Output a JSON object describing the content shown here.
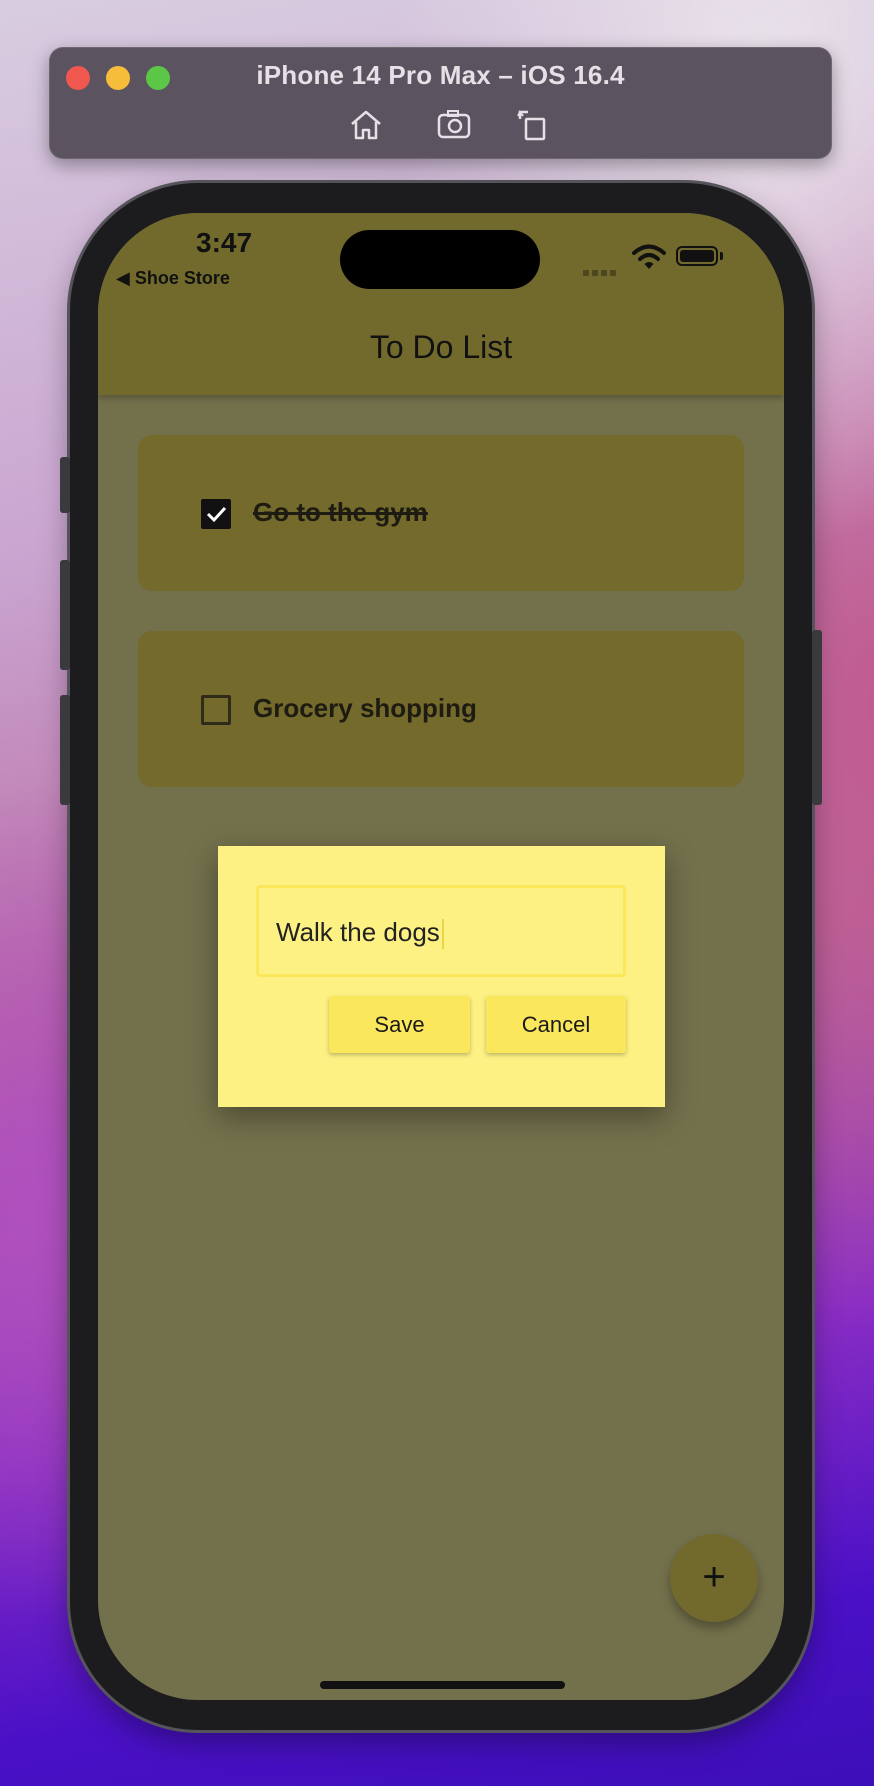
{
  "simulator": {
    "title": "iPhone 14 Pro Max – iOS 16.4",
    "buttons": [
      "home-icon",
      "screenshot-icon",
      "rotate-icon"
    ]
  },
  "status_bar": {
    "time": "3:47",
    "back_label": "◀ Shoe Store"
  },
  "app": {
    "title": "To Do List",
    "tasks": [
      {
        "label": "Go to the gym",
        "checked": true
      },
      {
        "label": "Grocery shopping",
        "checked": false
      }
    ],
    "fab_label": "+"
  },
  "dialog": {
    "input_value": "Walk the dogs",
    "save_label": "Save",
    "cancel_label": "Cancel"
  },
  "colors": {
    "app_bar": "#726a2c",
    "dialog_bg": "#fdf184",
    "button_bg": "#fbe75c"
  }
}
